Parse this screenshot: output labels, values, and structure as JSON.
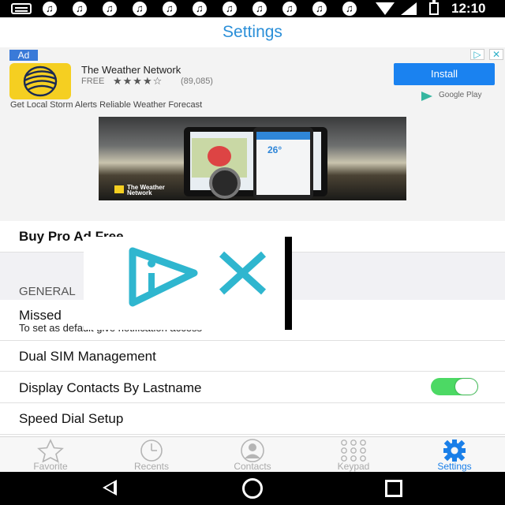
{
  "status_bar": {
    "time": "12:10",
    "icons": [
      "keyboard-icon",
      "music-note-icon",
      "wifi-icon",
      "cell-signal-icon",
      "battery-charging-icon"
    ]
  },
  "header": {
    "title": "Settings"
  },
  "ad": {
    "badge": "Ad",
    "adchoices_info": "▷",
    "adchoices_close": "✕",
    "app_name": "The Weather Network",
    "price": "FREE",
    "stars": "★★★★☆",
    "rating_count": "(89,085)",
    "install_label": "Install",
    "store_label": "Google Play",
    "tagline": "Get Local Storm Alerts Reliable Weather Forecast",
    "banner": {
      "brand": "The Weather\nNetwork",
      "temperature": "26°"
    }
  },
  "settings": {
    "buy_pro": "Buy Pro Ad Free",
    "section_general": "GENERAL",
    "missed_label": "Missed",
    "missed_sub": "To set as default give notification access",
    "dual_sim": "Dual SIM Management",
    "display_contacts": "Display Contacts By Lastname",
    "display_contacts_on": true,
    "speed_dial": "Speed Dial Setup"
  },
  "tabs": [
    {
      "label": "Favorite",
      "icon": "star-icon",
      "active": false
    },
    {
      "label": "Recents",
      "icon": "clock-icon",
      "active": false
    },
    {
      "label": "Contacts",
      "icon": "person-icon",
      "active": false
    },
    {
      "label": "Keypad",
      "icon": "keypad-icon",
      "active": false
    },
    {
      "label": "Settings",
      "icon": "gear-icon",
      "active": true
    }
  ],
  "colors": {
    "accent": "#1a7fe8",
    "title": "#2b8fd8",
    "toggle_on": "#4cd964",
    "install": "#1a82f0"
  }
}
